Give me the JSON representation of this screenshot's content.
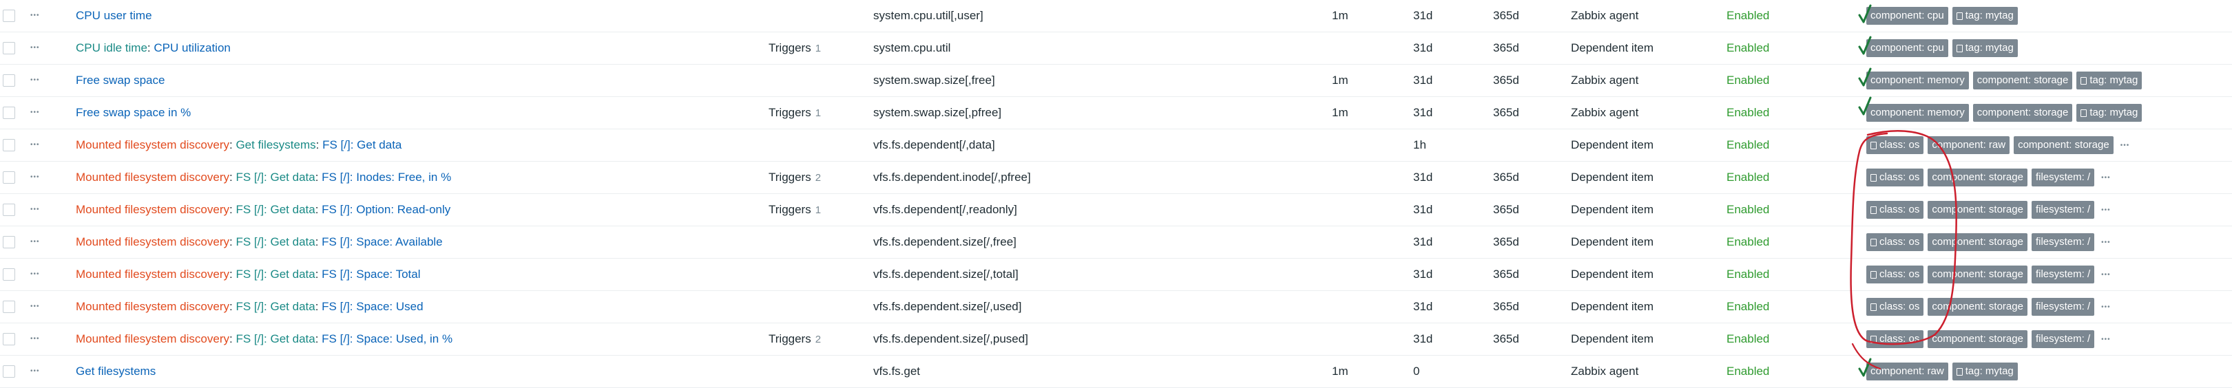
{
  "colors": {
    "link": "#0b64b8",
    "discovery_rule": "#e24b1f",
    "template_link": "#1a8a86",
    "enabled": "#2f9b2f",
    "tag_bg": "#7b8791",
    "annotation": "#cc1f2d",
    "checkmark": "#1c7a3a"
  },
  "icons": {
    "row_menu": "more-dots-icon",
    "tag_file": "file-icon",
    "tags_more": "more-dots-icon"
  },
  "rows": [
    {
      "name_parts": [
        {
          "text": "CPU user time",
          "style": "link-blue"
        }
      ],
      "triggers": "",
      "triggers_count": "",
      "key": "system.cpu.util[,user]",
      "interval": "1m",
      "history": "31d",
      "trends": "365d",
      "type": "Zabbix agent",
      "status": "Enabled",
      "tags": [
        {
          "text": "component: cpu",
          "icon": false
        },
        {
          "text": "tag: mytag",
          "icon": true
        }
      ],
      "tags_more": false
    },
    {
      "name_parts": [
        {
          "text": "CPU idle time",
          "style": "link-teal"
        },
        {
          "text": ": ",
          "style": "sep"
        },
        {
          "text": "CPU utilization",
          "style": "link-blue"
        }
      ],
      "triggers": "Triggers",
      "triggers_count": "1",
      "key": "system.cpu.util",
      "interval": "",
      "history": "31d",
      "trends": "365d",
      "type": "Dependent item",
      "status": "Enabled",
      "tags": [
        {
          "text": "component: cpu",
          "icon": false
        },
        {
          "text": "tag: mytag",
          "icon": true
        }
      ],
      "tags_more": false
    },
    {
      "name_parts": [
        {
          "text": "Free swap space",
          "style": "link-blue"
        }
      ],
      "triggers": "",
      "triggers_count": "",
      "key": "system.swap.size[,free]",
      "interval": "1m",
      "history": "31d",
      "trends": "365d",
      "type": "Zabbix agent",
      "status": "Enabled",
      "tags": [
        {
          "text": "component: memory",
          "icon": false
        },
        {
          "text": "component: storage",
          "icon": false
        },
        {
          "text": "tag: mytag",
          "icon": true
        }
      ],
      "tags_more": false
    },
    {
      "name_parts": [
        {
          "text": "Free swap space in %",
          "style": "link-blue"
        }
      ],
      "triggers": "Triggers",
      "triggers_count": "1",
      "key": "system.swap.size[,pfree]",
      "interval": "1m",
      "history": "31d",
      "trends": "365d",
      "type": "Zabbix agent",
      "status": "Enabled",
      "tags": [
        {
          "text": "component: memory",
          "icon": false
        },
        {
          "text": "component: storage",
          "icon": false
        },
        {
          "text": "tag: mytag",
          "icon": true
        }
      ],
      "tags_more": false
    },
    {
      "name_parts": [
        {
          "text": "Mounted filesystem discovery",
          "style": "link-red"
        },
        {
          "text": ": ",
          "style": "sep"
        },
        {
          "text": "Get filesystems",
          "style": "link-teal"
        },
        {
          "text": ": ",
          "style": "sep"
        },
        {
          "text": "FS [/]: Get data",
          "style": "link-blue"
        }
      ],
      "triggers": "",
      "triggers_count": "",
      "key": "vfs.fs.dependent[/,data]",
      "interval": "",
      "history": "1h",
      "trends": "",
      "type": "Dependent item",
      "status": "Enabled",
      "tags": [
        {
          "text": "class: os",
          "icon": true
        },
        {
          "text": "component: raw",
          "icon": false
        },
        {
          "text": "component: storage",
          "icon": false
        }
      ],
      "tags_more": true
    },
    {
      "name_parts": [
        {
          "text": "Mounted filesystem discovery",
          "style": "link-red"
        },
        {
          "text": ": ",
          "style": "sep"
        },
        {
          "text": "FS [/]: Get data",
          "style": "link-teal"
        },
        {
          "text": ": ",
          "style": "sep"
        },
        {
          "text": "FS [/]: Inodes: Free, in %",
          "style": "link-blue"
        }
      ],
      "triggers": "Triggers",
      "triggers_count": "2",
      "key": "vfs.fs.dependent.inode[/,pfree]",
      "interval": "",
      "history": "31d",
      "trends": "365d",
      "type": "Dependent item",
      "status": "Enabled",
      "tags": [
        {
          "text": "class: os",
          "icon": true
        },
        {
          "text": "component: storage",
          "icon": false
        },
        {
          "text": "filesystem: /",
          "icon": false
        }
      ],
      "tags_more": true
    },
    {
      "name_parts": [
        {
          "text": "Mounted filesystem discovery",
          "style": "link-red"
        },
        {
          "text": ": ",
          "style": "sep"
        },
        {
          "text": "FS [/]: Get data",
          "style": "link-teal"
        },
        {
          "text": ": ",
          "style": "sep"
        },
        {
          "text": "FS [/]: Option: Read-only",
          "style": "link-blue"
        }
      ],
      "triggers": "Triggers",
      "triggers_count": "1",
      "key": "vfs.fs.dependent[/,readonly]",
      "interval": "",
      "history": "31d",
      "trends": "365d",
      "type": "Dependent item",
      "status": "Enabled",
      "tags": [
        {
          "text": "class: os",
          "icon": true
        },
        {
          "text": "component: storage",
          "icon": false
        },
        {
          "text": "filesystem: /",
          "icon": false
        }
      ],
      "tags_more": true
    },
    {
      "name_parts": [
        {
          "text": "Mounted filesystem discovery",
          "style": "link-red"
        },
        {
          "text": ": ",
          "style": "sep"
        },
        {
          "text": "FS [/]: Get data",
          "style": "link-teal"
        },
        {
          "text": ": ",
          "style": "sep"
        },
        {
          "text": "FS [/]: Space: Available",
          "style": "link-blue"
        }
      ],
      "triggers": "",
      "triggers_count": "",
      "key": "vfs.fs.dependent.size[/,free]",
      "interval": "",
      "history": "31d",
      "trends": "365d",
      "type": "Dependent item",
      "status": "Enabled",
      "tags": [
        {
          "text": "class: os",
          "icon": true
        },
        {
          "text": "component: storage",
          "icon": false
        },
        {
          "text": "filesystem: /",
          "icon": false
        }
      ],
      "tags_more": true
    },
    {
      "name_parts": [
        {
          "text": "Mounted filesystem discovery",
          "style": "link-red"
        },
        {
          "text": ": ",
          "style": "sep"
        },
        {
          "text": "FS [/]: Get data",
          "style": "link-teal"
        },
        {
          "text": ": ",
          "style": "sep"
        },
        {
          "text": "FS [/]: Space: Total",
          "style": "link-blue"
        }
      ],
      "triggers": "",
      "triggers_count": "",
      "key": "vfs.fs.dependent.size[/,total]",
      "interval": "",
      "history": "31d",
      "trends": "365d",
      "type": "Dependent item",
      "status": "Enabled",
      "tags": [
        {
          "text": "class: os",
          "icon": true
        },
        {
          "text": "component: storage",
          "icon": false
        },
        {
          "text": "filesystem: /",
          "icon": false
        }
      ],
      "tags_more": true
    },
    {
      "name_parts": [
        {
          "text": "Mounted filesystem discovery",
          "style": "link-red"
        },
        {
          "text": ": ",
          "style": "sep"
        },
        {
          "text": "FS [/]: Get data",
          "style": "link-teal"
        },
        {
          "text": ": ",
          "style": "sep"
        },
        {
          "text": "FS [/]: Space: Used",
          "style": "link-blue"
        }
      ],
      "triggers": "",
      "triggers_count": "",
      "key": "vfs.fs.dependent.size[/,used]",
      "interval": "",
      "history": "31d",
      "trends": "365d",
      "type": "Dependent item",
      "status": "Enabled",
      "tags": [
        {
          "text": "class: os",
          "icon": true
        },
        {
          "text": "component: storage",
          "icon": false
        },
        {
          "text": "filesystem: /",
          "icon": false
        }
      ],
      "tags_more": true
    },
    {
      "name_parts": [
        {
          "text": "Mounted filesystem discovery",
          "style": "link-red"
        },
        {
          "text": ": ",
          "style": "sep"
        },
        {
          "text": "FS [/]: Get data",
          "style": "link-teal"
        },
        {
          "text": ": ",
          "style": "sep"
        },
        {
          "text": "FS [/]: Space: Used, in %",
          "style": "link-blue"
        }
      ],
      "triggers": "Triggers",
      "triggers_count": "2",
      "key": "vfs.fs.dependent.size[/,pused]",
      "interval": "",
      "history": "31d",
      "trends": "365d",
      "type": "Dependent item",
      "status": "Enabled",
      "tags": [
        {
          "text": "class: os",
          "icon": true
        },
        {
          "text": "component: storage",
          "icon": false
        },
        {
          "text": "filesystem: /",
          "icon": false
        }
      ],
      "tags_more": true
    },
    {
      "name_parts": [
        {
          "text": "Get filesystems",
          "style": "link-blue"
        }
      ],
      "triggers": "",
      "triggers_count": "",
      "key": "vfs.fs.get",
      "interval": "1m",
      "history": "0",
      "trends": "",
      "type": "Zabbix agent",
      "status": "Enabled",
      "tags": [
        {
          "text": "component: raw",
          "icon": false
        },
        {
          "text": "tag: mytag",
          "icon": true
        }
      ],
      "tags_more": false
    }
  ]
}
